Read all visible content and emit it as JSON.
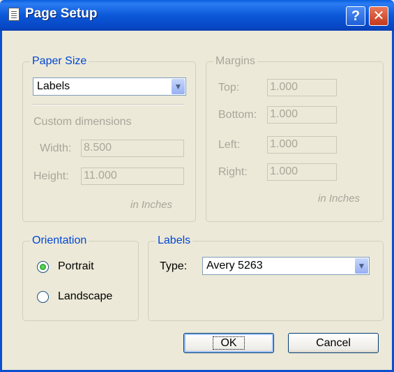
{
  "window": {
    "title": "Page Setup",
    "help_label": "?",
    "close_label": "✕",
    "icon": "document-icon"
  },
  "paper_size": {
    "group_label": "Paper Size",
    "selected": "Labels",
    "custom_label": "Custom dimensions",
    "width_label": "Width:",
    "width_value": "8.500",
    "height_label": "Height:",
    "height_value": "11.000",
    "unit": "in Inches"
  },
  "margins": {
    "group_label": "Margins",
    "top_label": "Top:",
    "top_value": "1.000",
    "bottom_label": "Bottom:",
    "bottom_value": "1.000",
    "left_label": "Left:",
    "left_value": "1.000",
    "right_label": "Right:",
    "right_value": "1.000",
    "unit": "in Inches"
  },
  "orientation": {
    "group_label": "Orientation",
    "portrait_label": "Portrait",
    "landscape_label": "Landscape",
    "selected": "Portrait"
  },
  "labels": {
    "group_label": "Labels",
    "type_label": "Type:",
    "type_value": "Avery 5263"
  },
  "buttons": {
    "ok_label": "OK",
    "cancel_label": "Cancel"
  }
}
